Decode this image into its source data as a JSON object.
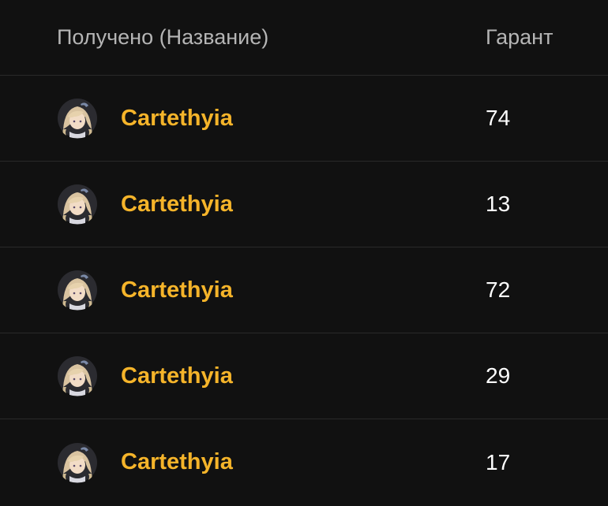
{
  "header": {
    "name_label": "Получено (Название)",
    "pity_label": "Гарант"
  },
  "rows": [
    {
      "name": "Cartethyia",
      "pity": "74",
      "avatar_icon": "cartethyia-avatar-icon"
    },
    {
      "name": "Cartethyia",
      "pity": "13",
      "avatar_icon": "cartethyia-avatar-icon"
    },
    {
      "name": "Cartethyia",
      "pity": "72",
      "avatar_icon": "cartethyia-avatar-icon"
    },
    {
      "name": "Cartethyia",
      "pity": "29",
      "avatar_icon": "cartethyia-avatar-icon"
    },
    {
      "name": "Cartethyia",
      "pity": "17",
      "avatar_icon": "cartethyia-avatar-icon"
    }
  ],
  "colors": {
    "background": "#111111",
    "accent_name": "#f5b42a",
    "header_text": "#b5b5b5",
    "divider": "#2a2a2a"
  }
}
